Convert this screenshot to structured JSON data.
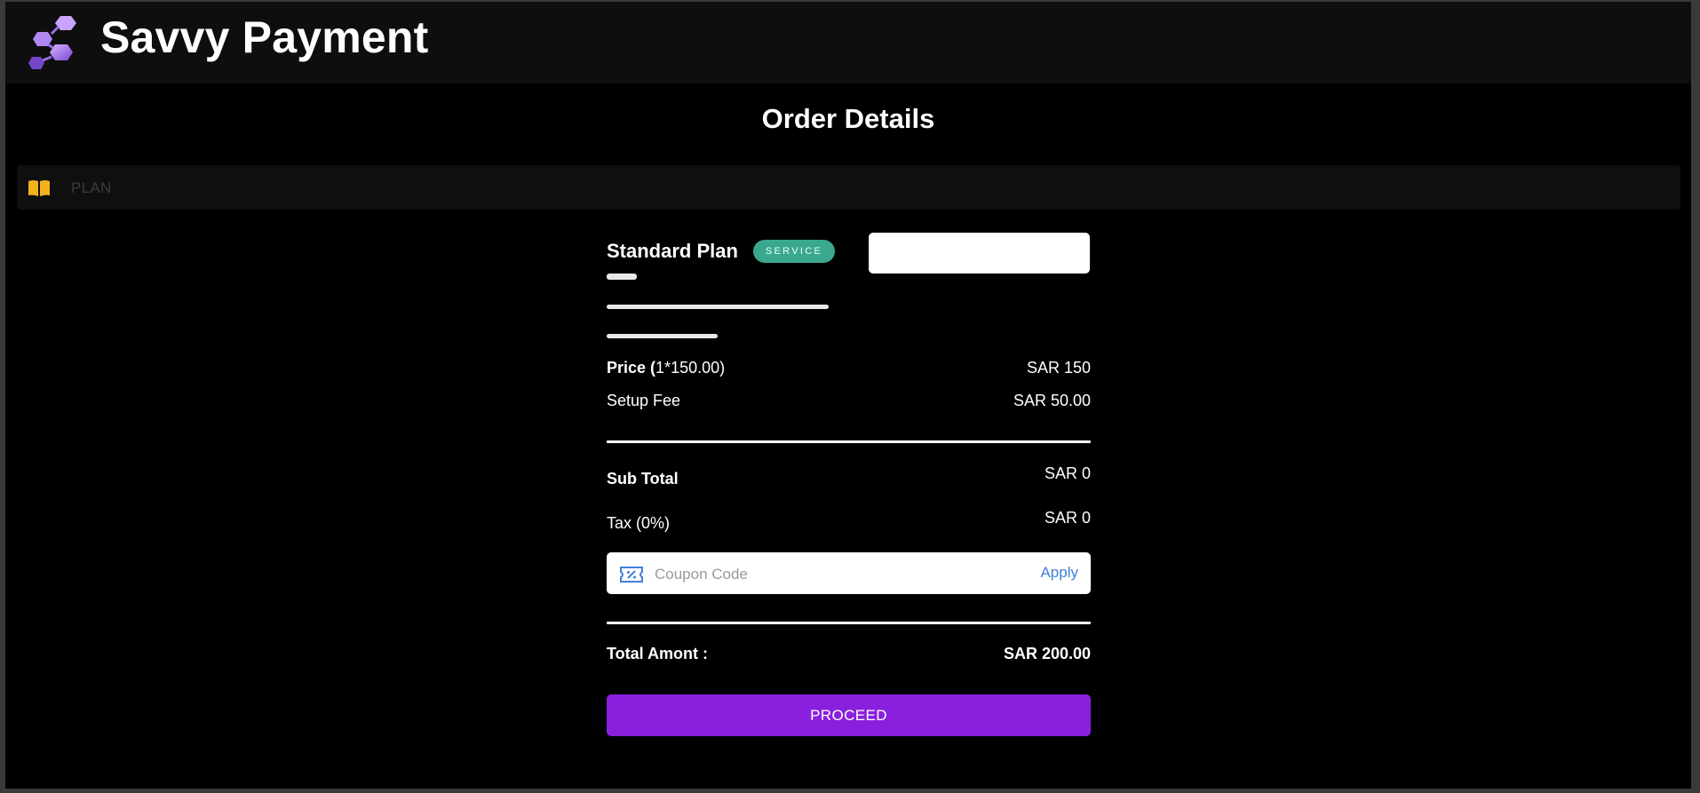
{
  "header": {
    "brand": "Savvy Payment",
    "logo_icon": "hexagon-cluster-logo"
  },
  "page": {
    "title": "Order Details"
  },
  "section": {
    "label": "PLAN",
    "icon": "open-book-icon"
  },
  "plan": {
    "name": "Standard Plan",
    "badge": "SERVICE"
  },
  "pricing": {
    "price_label": "Price",
    "price_detail": "(1*150.00)",
    "price_value": "SAR 150",
    "setup_fee_label": "Setup Fee",
    "setup_fee_value": "SAR 50.00",
    "subtotal_label": "Sub Total",
    "subtotal_value": "SAR 0",
    "tax_label": "Tax (0%)",
    "tax_value": "SAR 0",
    "total_label": "Total Amont :",
    "total_value": "SAR 200.00"
  },
  "coupon": {
    "placeholder": "Coupon Code",
    "apply_label": "Apply",
    "icon": "coupon-ticket-icon"
  },
  "actions": {
    "proceed_label": "PROCEED"
  },
  "colors": {
    "accent": "#8a1fde",
    "badge": "#3aa88e",
    "link": "#3f7fd9",
    "book_icon": "#f2b21b"
  }
}
